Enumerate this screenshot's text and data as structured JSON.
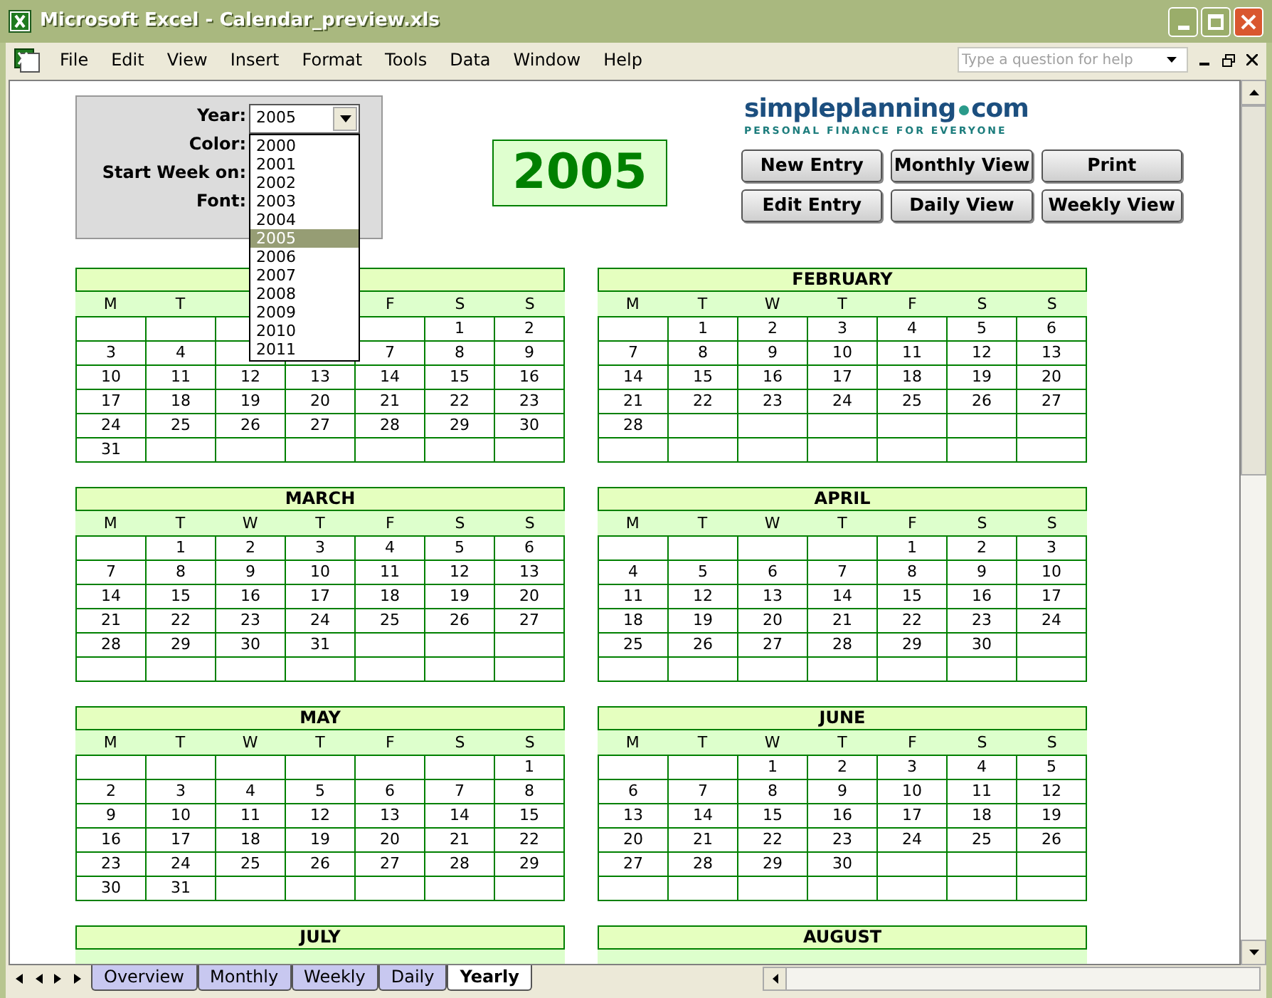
{
  "window": {
    "title": "Microsoft Excel - Calendar_preview.xls"
  },
  "menu": [
    {
      "label": "File"
    },
    {
      "label": "Edit"
    },
    {
      "label": "View"
    },
    {
      "label": "Insert"
    },
    {
      "label": "Format"
    },
    {
      "label": "Tools"
    },
    {
      "label": "Data"
    },
    {
      "label": "Window"
    },
    {
      "label": "Help"
    }
  ],
  "help_field": {
    "placeholder": "Type a question for help"
  },
  "settings": {
    "labels": [
      "Year:",
      "Color:",
      "Start Week on:",
      "Font:"
    ],
    "year_value": "2005",
    "year_options": [
      {
        "label": "2000",
        "selected": false
      },
      {
        "label": "2001",
        "selected": false
      },
      {
        "label": "2002",
        "selected": false
      },
      {
        "label": "2003",
        "selected": false
      },
      {
        "label": "2004",
        "selected": false
      },
      {
        "label": "2005",
        "selected": true
      },
      {
        "label": "2006",
        "selected": false
      },
      {
        "label": "2007",
        "selected": false
      },
      {
        "label": "2008",
        "selected": false
      },
      {
        "label": "2009",
        "selected": false
      },
      {
        "label": "2010",
        "selected": false
      },
      {
        "label": "2011",
        "selected": false
      }
    ]
  },
  "year_display": "2005",
  "buttons": [
    "New Entry",
    "Monthly View",
    "Print",
    "Edit Entry",
    "Daily View",
    "Weekly View"
  ],
  "logo": {
    "name": "simpleplanning",
    "suffix": "com",
    "tagline": "PERSONAL FINANCE FOR EVERYONE"
  },
  "month_rows": [
    {
      "left": {
        "header": {
          "kind": "split",
          "before": [
            "M",
            "T"
          ],
          "after": [
            "F",
            "S",
            "S"
          ]
        },
        "weeks": [
          {
            "kind": "start",
            "days": [
              "1",
              "2"
            ]
          },
          {
            "kind": "split",
            "before": [
              "3",
              "4"
            ],
            "after": [
              "7",
              "8",
              "9"
            ]
          },
          {
            "kind": "full",
            "days": [
              "10",
              "11",
              "12",
              "13",
              "14",
              "15",
              "16"
            ]
          },
          {
            "kind": "full",
            "days": [
              "17",
              "18",
              "19",
              "20",
              "21",
              "22",
              "23"
            ]
          },
          {
            "kind": "full",
            "days": [
              "24",
              "25",
              "26",
              "27",
              "28",
              "29",
              "30"
            ]
          },
          {
            "kind": "end",
            "days": [
              "31"
            ]
          }
        ]
      },
      "right": {
        "title": "FEBRUARY",
        "header": {
          "kind": "full",
          "labels": [
            "M",
            "T",
            "W",
            "T",
            "F",
            "S",
            "S"
          ]
        },
        "weeks": [
          {
            "kind": "start",
            "days": [
              "1",
              "2",
              "3",
              "4",
              "5",
              "6"
            ]
          },
          {
            "kind": "full",
            "days": [
              "7",
              "8",
              "9",
              "10",
              "11",
              "12",
              "13"
            ]
          },
          {
            "kind": "full",
            "days": [
              "14",
              "15",
              "16",
              "17",
              "18",
              "19",
              "20"
            ]
          },
          {
            "kind": "full",
            "days": [
              "21",
              "22",
              "23",
              "24",
              "25",
              "26",
              "27"
            ]
          },
          {
            "kind": "end",
            "days": [
              "28"
            ]
          },
          {
            "kind": "empty"
          }
        ]
      }
    },
    {
      "left": {
        "title": "MARCH",
        "header": {
          "kind": "full",
          "labels": [
            "M",
            "T",
            "W",
            "T",
            "F",
            "S",
            "S"
          ]
        },
        "weeks": [
          {
            "kind": "start",
            "days": [
              "1",
              "2",
              "3",
              "4",
              "5",
              "6"
            ]
          },
          {
            "kind": "full",
            "days": [
              "7",
              "8",
              "9",
              "10",
              "11",
              "12",
              "13"
            ]
          },
          {
            "kind": "full",
            "days": [
              "14",
              "15",
              "16",
              "17",
              "18",
              "19",
              "20"
            ]
          },
          {
            "kind": "full",
            "days": [
              "21",
              "22",
              "23",
              "24",
              "25",
              "26",
              "27"
            ]
          },
          {
            "kind": "end",
            "days": [
              "28",
              "29",
              "30",
              "31"
            ]
          },
          {
            "kind": "empty"
          }
        ]
      },
      "right": {
        "title": "APRIL",
        "header": {
          "kind": "full",
          "labels": [
            "M",
            "T",
            "W",
            "T",
            "F",
            "S",
            "S"
          ]
        },
        "weeks": [
          {
            "kind": "start",
            "days": [
              "1",
              "2",
              "3"
            ]
          },
          {
            "kind": "full",
            "days": [
              "4",
              "5",
              "6",
              "7",
              "8",
              "9",
              "10"
            ]
          },
          {
            "kind": "full",
            "days": [
              "11",
              "12",
              "13",
              "14",
              "15",
              "16",
              "17"
            ]
          },
          {
            "kind": "full",
            "days": [
              "18",
              "19",
              "20",
              "21",
              "22",
              "23",
              "24"
            ]
          },
          {
            "kind": "end",
            "days": [
              "25",
              "26",
              "27",
              "28",
              "29",
              "30"
            ]
          },
          {
            "kind": "empty"
          }
        ]
      }
    },
    {
      "left": {
        "title": "MAY",
        "header": {
          "kind": "full",
          "labels": [
            "M",
            "T",
            "W",
            "T",
            "F",
            "S",
            "S"
          ]
        },
        "weeks": [
          {
            "kind": "start",
            "days": [
              "1"
            ]
          },
          {
            "kind": "full",
            "days": [
              "2",
              "3",
              "4",
              "5",
              "6",
              "7",
              "8"
            ]
          },
          {
            "kind": "full",
            "days": [
              "9",
              "10",
              "11",
              "12",
              "13",
              "14",
              "15"
            ]
          },
          {
            "kind": "full",
            "days": [
              "16",
              "17",
              "18",
              "19",
              "20",
              "21",
              "22"
            ]
          },
          {
            "kind": "full",
            "days": [
              "23",
              "24",
              "25",
              "26",
              "27",
              "28",
              "29"
            ]
          },
          {
            "kind": "end",
            "days": [
              "30",
              "31"
            ]
          }
        ]
      },
      "right": {
        "title": "JUNE",
        "header": {
          "kind": "full",
          "labels": [
            "M",
            "T",
            "W",
            "T",
            "F",
            "S",
            "S"
          ]
        },
        "weeks": [
          {
            "kind": "start",
            "days": [
              "1",
              "2",
              "3",
              "4",
              "5"
            ]
          },
          {
            "kind": "full",
            "days": [
              "6",
              "7",
              "8",
              "9",
              "10",
              "11",
              "12"
            ]
          },
          {
            "kind": "full",
            "days": [
              "13",
              "14",
              "15",
              "16",
              "17",
              "18",
              "19"
            ]
          },
          {
            "kind": "full",
            "days": [
              "20",
              "21",
              "22",
              "23",
              "24",
              "25",
              "26"
            ]
          },
          {
            "kind": "end",
            "days": [
              "27",
              "28",
              "29",
              "30"
            ]
          },
          {
            "kind": "empty"
          }
        ]
      }
    },
    {
      "left": {
        "title": "JULY",
        "header": {
          "kind": "cut"
        }
      },
      "right": {
        "title": "AUGUST",
        "header": {
          "kind": "cut"
        }
      }
    }
  ],
  "sheet_tabs": [
    {
      "label": "Overview",
      "selected": false
    },
    {
      "label": "Monthly",
      "selected": false
    },
    {
      "label": "Weekly",
      "selected": false
    },
    {
      "label": "Daily",
      "selected": false
    },
    {
      "label": "Yearly",
      "selected": true
    }
  ]
}
